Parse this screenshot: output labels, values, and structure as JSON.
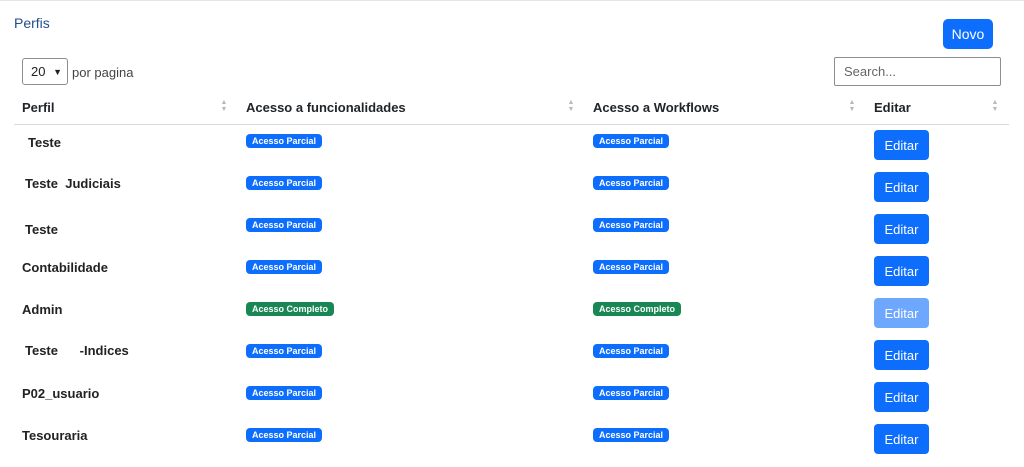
{
  "page": {
    "title": "Perfis",
    "new_button": "Novo"
  },
  "controls": {
    "page_size": "20",
    "per_page_label": "por pagina",
    "search_placeholder": "Search..."
  },
  "table": {
    "columns": [
      "Perfil",
      "Acesso a funcionalidades",
      "Acesso a Workflows",
      "Editar"
    ],
    "rows": [
      {
        "name": "Teste",
        "funcionalidades": "Acesso Parcial",
        "workflows": "Acesso Parcial",
        "edit": "Editar"
      },
      {
        "name": "Teste  Judiciais",
        "funcionalidades": "Acesso Parcial",
        "workflows": "Acesso Parcial",
        "edit": "Editar"
      },
      {
        "name": "Teste",
        "funcionalidades": "Acesso Parcial",
        "workflows": "Acesso Parcial",
        "edit": "Editar"
      },
      {
        "name": "Contabilidade",
        "funcionalidades": "Acesso Parcial",
        "workflows": "Acesso Parcial",
        "edit": "Editar"
      },
      {
        "name": "Admin",
        "funcionalidades": "Acesso Completo",
        "workflows": "Acesso Completo",
        "edit": "Editar"
      },
      {
        "name": "Teste      -Indices",
        "funcionalidades": "Acesso Parcial",
        "workflows": "Acesso Parcial",
        "edit": "Editar"
      },
      {
        "name": "P02_usuario",
        "funcionalidades": "Acesso Parcial",
        "workflows": "Acesso Parcial",
        "edit": "Editar"
      },
      {
        "name": "Tesouraria",
        "funcionalidades": "Acesso Parcial",
        "workflows": "Acesso Parcial",
        "edit": "Editar"
      }
    ]
  },
  "colors": {
    "primary": "#0d6efd",
    "success": "#198754",
    "disabled_primary": "#6ea8fe",
    "title": "#1f4e8c"
  },
  "icons": {
    "sort": "sort-arrows-icon",
    "dropdown": "chevron-down-icon"
  }
}
